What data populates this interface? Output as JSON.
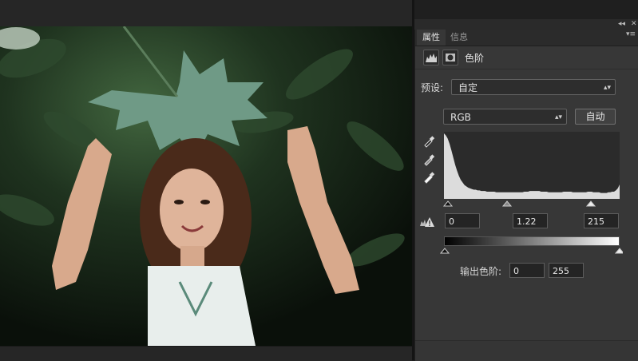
{
  "panel": {
    "collapse_icon": "◂◂",
    "close_icon": "✕",
    "menu_icon": "▾≡",
    "tabs": [
      {
        "label": "属性",
        "active": true
      },
      {
        "label": "信息",
        "active": false
      }
    ],
    "title": "色阶",
    "preset_label": "预设:",
    "preset_value": "自定",
    "channel_value": "RGB",
    "auto_label": "自动",
    "input_levels": {
      "black": "0",
      "gamma": "1.22",
      "white": "215"
    },
    "output_label": "输出色阶:",
    "output_levels": {
      "black": "0",
      "white": "255"
    },
    "histogram_profile": [
      100,
      97,
      92,
      84,
      74,
      63,
      52,
      43,
      35,
      29,
      25,
      21,
      19,
      17,
      16,
      15,
      14,
      14,
      13,
      13,
      12,
      12,
      12,
      11,
      11,
      11,
      11,
      11,
      10,
      10,
      10,
      10,
      10,
      10,
      10,
      10,
      10,
      10,
      10,
      10,
      10,
      10,
      10,
      11,
      11,
      11,
      12,
      12,
      12,
      12,
      12,
      12,
      11,
      11,
      11,
      11,
      10,
      10,
      10,
      10,
      10,
      10,
      10,
      10,
      11,
      11,
      11,
      11,
      11,
      10,
      10,
      10,
      10,
      10,
      10,
      10,
      10,
      11,
      11,
      11,
      10,
      10,
      10,
      10,
      9,
      9,
      9,
      9,
      10,
      10,
      11,
      11,
      13,
      16,
      22
    ]
  }
}
